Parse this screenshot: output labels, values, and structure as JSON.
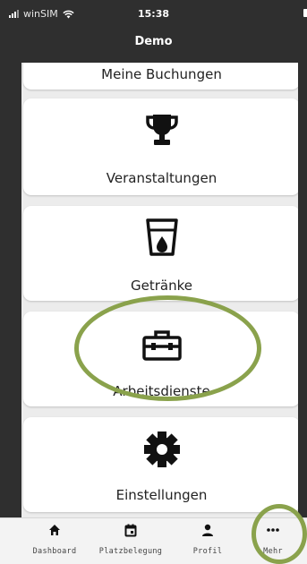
{
  "status_bar": {
    "carrier": "winSIM",
    "time": "15:38"
  },
  "header": {
    "title": "Demo"
  },
  "cards": [
    {
      "label": "Meine Buchungen",
      "icon": ""
    },
    {
      "label": "Veranstaltungen",
      "icon": "trophy-icon"
    },
    {
      "label": "Getränke",
      "icon": "drink-glass-icon"
    },
    {
      "label": "Arbeitsdienste",
      "icon": "toolbox-icon"
    },
    {
      "label": "Einstellungen",
      "icon": "gear-icon"
    }
  ],
  "bottom_nav": [
    {
      "label": "Dashboard",
      "icon": "home-icon"
    },
    {
      "label": "Platzbelegung",
      "icon": "calendar-icon"
    },
    {
      "label": "Profil",
      "icon": "person-icon"
    },
    {
      "label": "Mehr",
      "icon": "more-dots-icon"
    }
  ],
  "colors": {
    "header_bg": "#2f2f2f",
    "highlight": "#8aa24c"
  }
}
